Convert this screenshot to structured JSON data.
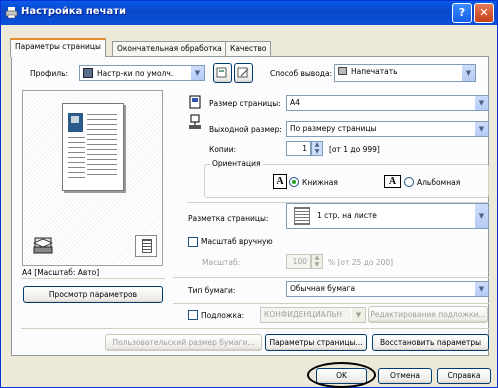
{
  "window": {
    "title": "Настройка печати",
    "help_btn": "?",
    "close_btn": "✕"
  },
  "tabs": [
    {
      "label": "Параметры страницы"
    },
    {
      "label": "Окончательная обработка"
    },
    {
      "label": "Качество"
    }
  ],
  "profile": {
    "label": "Профиль:",
    "value": "Настр-ки по умолч."
  },
  "output_method": {
    "label": "Способ вывода:",
    "value": "Напечатать"
  },
  "page_size": {
    "label": "Размер страницы:",
    "value": "A4"
  },
  "output_size": {
    "label": "Выходной размер:",
    "value": "По размеру страницы"
  },
  "copies": {
    "label": "Копии:",
    "value": "1",
    "range": "[от 1 до 999]"
  },
  "orientation": {
    "label": "Ориентация",
    "portrait": "Книжная",
    "landscape": "Альбомная",
    "letter": "A"
  },
  "layout": {
    "label": "Разметка страницы:",
    "value": "1 стр. на листе"
  },
  "manual_scale": {
    "label": "Масштаб вручную",
    "scale_label": "Масштаб:",
    "value": "100",
    "range": "% [от 25 до 200]"
  },
  "paper_type": {
    "label": "Тип бумаги:",
    "value": "Обычная бумага"
  },
  "watermark": {
    "label": "Подложка:",
    "value": "КОНФИДЕНЦИАЛЬН",
    "edit_btn": "Редактирование подложки..."
  },
  "preview": {
    "caption": "A4 [Масштаб: Авто]",
    "view_btn": "Просмотр параметров"
  },
  "bottom_buttons": {
    "custom_size": "Пользовательский размер бумаги...",
    "page_params": "Параметры страницы...",
    "restore": "Восстановить параметры"
  },
  "dialog_buttons": {
    "ok": "OK",
    "cancel": "Отмена",
    "help": "Справка"
  }
}
